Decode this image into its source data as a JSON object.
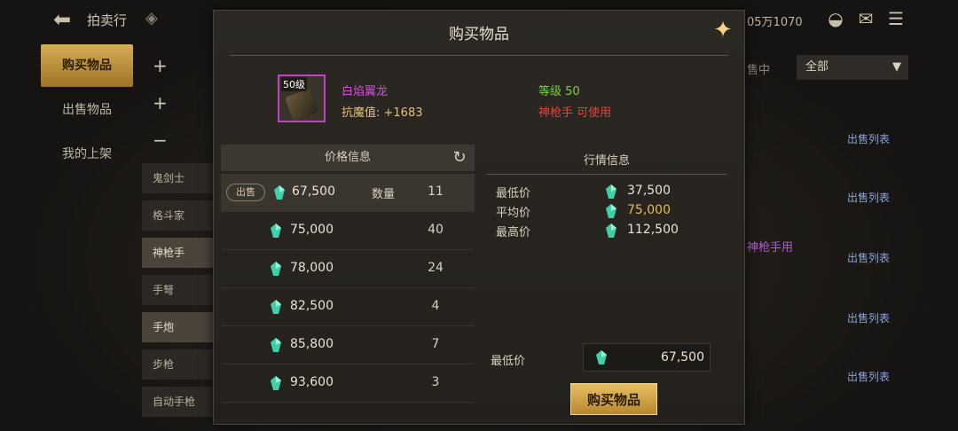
{
  "topbar": {
    "title": "拍卖行",
    "currency": "05万1070",
    "icons": [
      "back-icon",
      "diamond-icon",
      "bag-icon",
      "mail-icon",
      "chat-icon"
    ]
  },
  "nav": [
    {
      "label": "购买物品",
      "active": true
    },
    {
      "label": "出售物品",
      "active": false
    },
    {
      "label": "我的上架",
      "active": false
    }
  ],
  "categories": [
    "鬼剑士",
    "格斗家",
    "神枪手",
    "手弩",
    "手炮",
    "步枪",
    "自动手枪"
  ],
  "background": {
    "filter_label": "售中",
    "filter_value": "全部",
    "sell_list_label": "出售列表",
    "purple_text": "神枪手用"
  },
  "modal": {
    "title": "购买物品",
    "item": {
      "level_badge": "50级",
      "name": "白焰翼龙",
      "stat": "抗魔值: +1683",
      "level": "等级 50",
      "usable": "神枪手 可使用"
    },
    "price_panel": {
      "header": "价格信息",
      "sell_badge": "出售",
      "qty_label": "数量",
      "rows": [
        {
          "price": "67,500",
          "qty": "11"
        },
        {
          "price": "75,000",
          "qty": "40"
        },
        {
          "price": "78,000",
          "qty": "24"
        },
        {
          "price": "82,500",
          "qty": "4"
        },
        {
          "price": "85,800",
          "qty": "7"
        },
        {
          "price": "93,600",
          "qty": "3"
        }
      ]
    },
    "market_panel": {
      "header": "行情信息",
      "min_label": "最低价",
      "min_value": "37,500",
      "avg_label": "平均价",
      "avg_value": "75,000",
      "max_label": "最高价",
      "max_value": "112,500"
    },
    "buy": {
      "min_price_label": "最低价",
      "min_price_value": "67,500",
      "button": "购买物品"
    }
  },
  "colors": {
    "accent_gold": "#d7ad55",
    "item_name": "#d14dd6",
    "level_green": "#7ccb4a",
    "class_red": "#e2443a",
    "avg_gold": "#e9b94d"
  }
}
